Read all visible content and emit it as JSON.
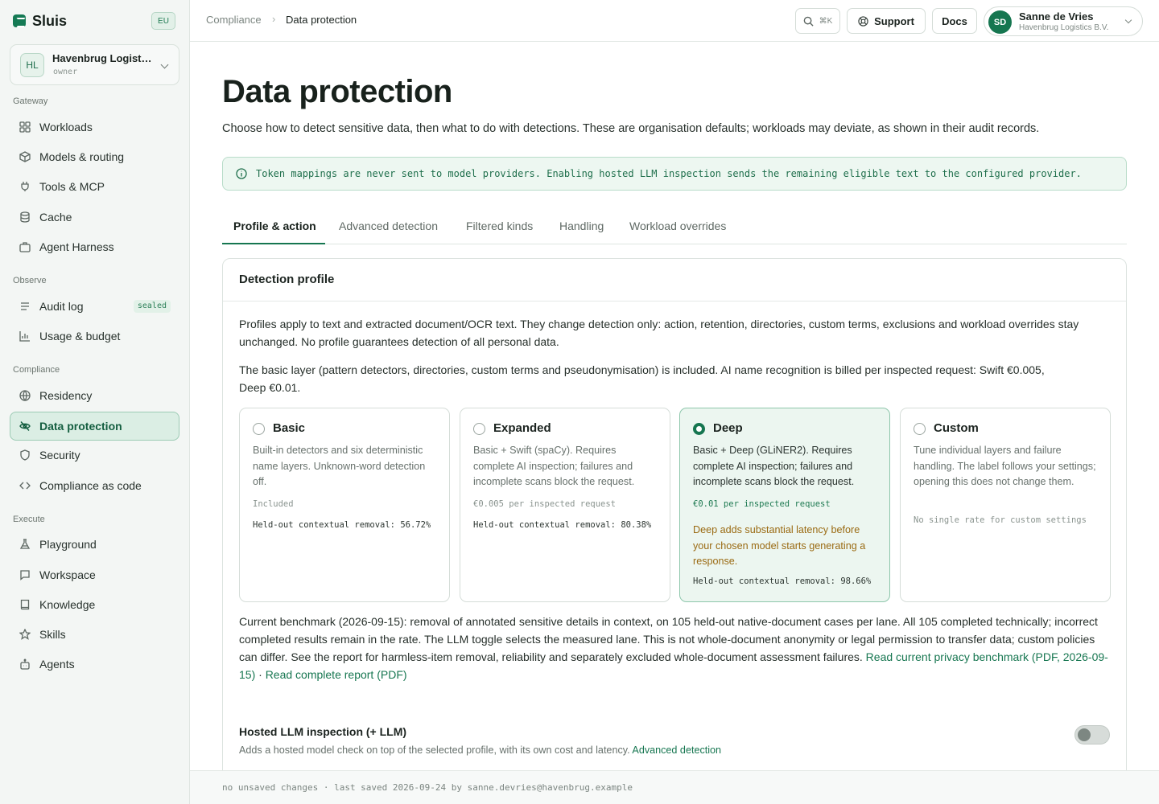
{
  "app": {
    "name": "Sluis",
    "region": "EU"
  },
  "org": {
    "initials": "HL",
    "name": "Havenbrug Logistics B.V.",
    "role": "owner"
  },
  "sidebar": {
    "sections": [
      {
        "label": "Gateway",
        "items": [
          {
            "label": "Workloads",
            "icon": "grid-icon"
          },
          {
            "label": "Models & routing",
            "icon": "cube-icon"
          },
          {
            "label": "Tools & MCP",
            "icon": "plug-icon"
          },
          {
            "label": "Cache",
            "icon": "database-icon"
          },
          {
            "label": "Agent Harness",
            "icon": "briefcase-icon"
          }
        ]
      },
      {
        "label": "Observe",
        "items": [
          {
            "label": "Audit log",
            "icon": "list-icon",
            "badge": "sealed"
          },
          {
            "label": "Usage & budget",
            "icon": "bar-chart-icon"
          }
        ]
      },
      {
        "label": "Compliance",
        "items": [
          {
            "label": "Residency",
            "icon": "globe-icon"
          },
          {
            "label": "Data protection",
            "icon": "eye-off-icon",
            "active": true
          },
          {
            "label": "Security",
            "icon": "shield-icon"
          },
          {
            "label": "Compliance as code",
            "icon": "code-icon"
          }
        ]
      },
      {
        "label": "Execute",
        "items": [
          {
            "label": "Playground",
            "icon": "flask-icon"
          },
          {
            "label": "Workspace",
            "icon": "chat-icon"
          },
          {
            "label": "Knowledge",
            "icon": "book-icon"
          },
          {
            "label": "Skills",
            "icon": "star-icon"
          },
          {
            "label": "Agents",
            "icon": "robot-icon"
          }
        ]
      }
    ]
  },
  "topbar": {
    "breadcrumb": {
      "parent": "Compliance",
      "separator": "›",
      "current": "Data protection"
    },
    "search_shortcut": "⌘K",
    "support_label": "Support",
    "docs_label": "Docs",
    "user": {
      "initials": "SD",
      "name": "Sanne de Vries",
      "org": "Havenbrug Logistics B.V."
    }
  },
  "page": {
    "title": "Data protection",
    "subtitle": "Choose how to detect sensitive data, then what to do with detections. These are organisation defaults; workloads may deviate, as shown in their audit records.",
    "notice": "Token mappings are never sent to model providers. Enabling hosted LLM inspection sends the remaining eligible text to the configured provider.",
    "tabs": [
      "Profile & action",
      "Advanced detection",
      "Filtered kinds",
      "Handling",
      "Workload overrides"
    ],
    "active_tab": "Profile & action"
  },
  "card": {
    "title": "Detection profile",
    "intro": "Profiles apply to text and extracted document/OCR text. They change detection only: action, retention, directories, custom terms, exclusions and workload overrides stay unchanged. No profile guarantees detection of all personal data.",
    "billing": "The basic layer (pattern detectors, directories, custom terms and pseudonymisation) is included. AI name recognition is billed per inspected request: Swift €0.005, Deep €0.01.",
    "profiles": [
      {
        "name": "Basic",
        "desc": "Built-in detectors and six deterministic name layers. Unknown-word detection off.",
        "price": "Included",
        "removal": "Held-out contextual removal: 56.72%",
        "selected": false
      },
      {
        "name": "Expanded",
        "desc": "Basic + Swift (spaCy). Requires complete AI inspection; failures and incomplete scans block the request.",
        "price": "€0.005 per inspected request",
        "removal": "Held-out contextual removal: 80.38%",
        "selected": false
      },
      {
        "name": "Deep",
        "desc": "Basic + Deep (GLiNER2). Requires complete AI inspection; failures and incomplete scans block the request.",
        "price": "€0.01 per inspected request",
        "warning": "Deep adds substantial latency before your chosen model starts generating a response.",
        "removal": "Held-out contextual removal: 98.66%",
        "selected": true
      },
      {
        "name": "Custom",
        "desc": "Tune individual layers and failure handling. The label follows your settings; opening this does not change them.",
        "price": "No single rate for custom settings",
        "selected": false
      }
    ],
    "benchmark_text": "Current benchmark (2026-09-15): removal of annotated sensitive details in context, on 105 held-out native-document cases per lane. All 105 completed technically; incorrect completed results remain in the rate. The LLM toggle selects the measured lane. This is not whole-document anonymity or legal permission to transfer data; custom policies can differ. See the report for harmless-item removal, reliability and separately excluded whole-document assessment failures. ",
    "benchmark_link": "Read current privacy benchmark (PDF, 2026-09-15)",
    "benchmark_sep": " · ",
    "report_link": "Read complete report (PDF)",
    "llm": {
      "title": "Hosted LLM inspection (+ LLM)",
      "desc": "Adds a hosted model check on top of the selected profile, with its own cost and latency. ",
      "link": "Advanced detection",
      "enabled": false
    }
  },
  "footer": {
    "status": "no unsaved changes · last saved 2026-09-24 by sanne.devries@havenbrug.example"
  },
  "colors": {
    "accent": "#167650",
    "accent_bg": "#ecf6f0",
    "warning": "#9a6a12"
  }
}
